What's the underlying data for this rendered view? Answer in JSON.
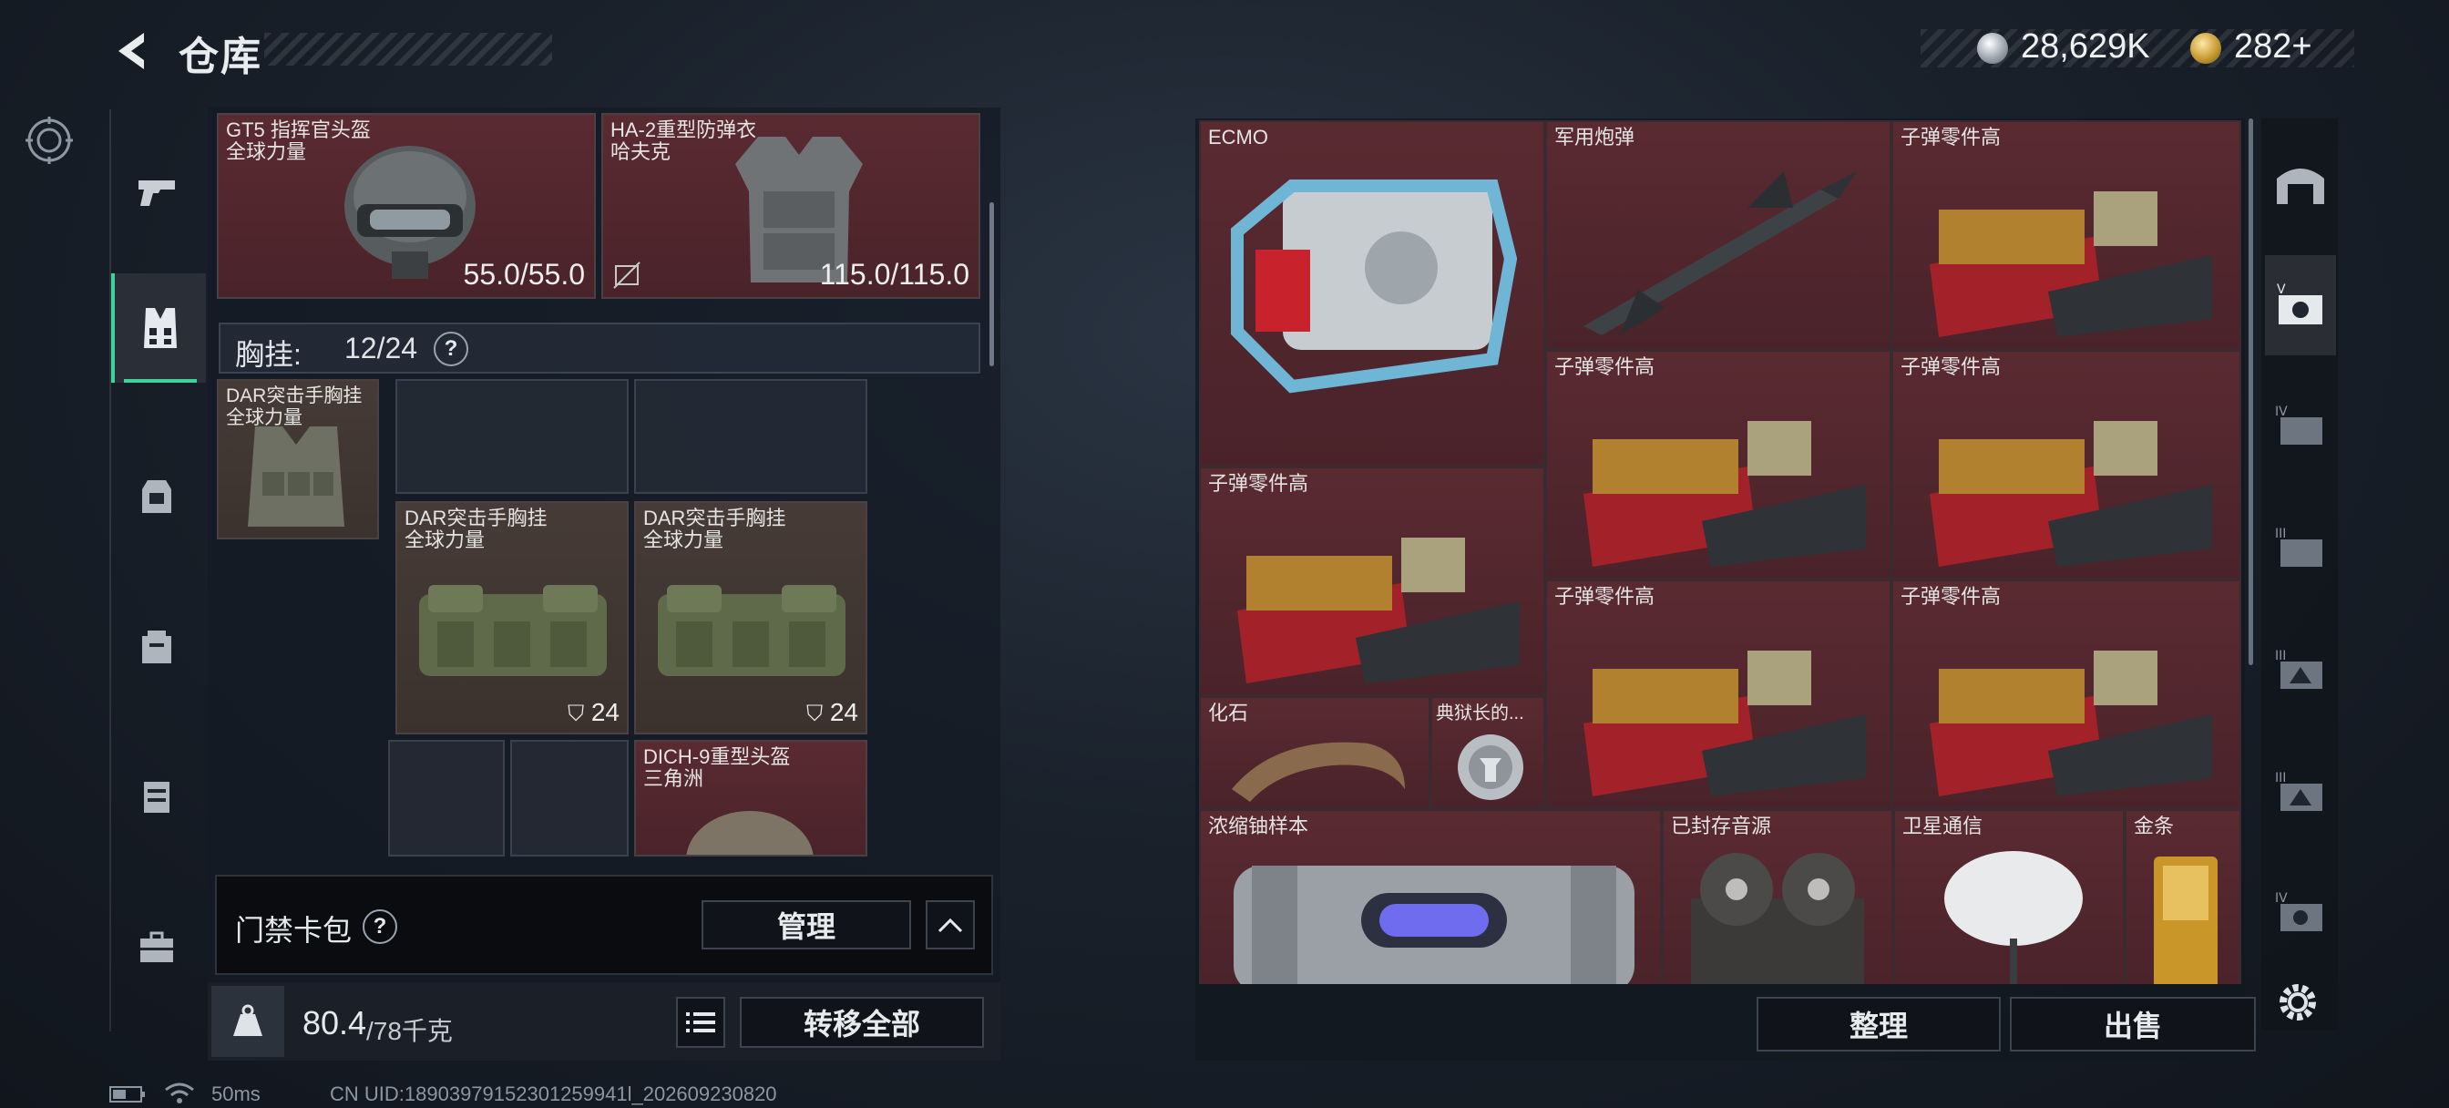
{
  "header": {
    "title": "仓库"
  },
  "currency": {
    "silver": "28,629K",
    "gold": "282",
    "gold_plus": "+"
  },
  "loadout": {
    "helmet": {
      "name": "GT5 指挥官头盔",
      "faction": "全球力量",
      "durability": "55.0/55.0"
    },
    "armor": {
      "name": "HA-2重型防弹衣",
      "faction": "哈夫克",
      "durability": "115.0/115.0"
    },
    "vest_header": {
      "label": "胸挂:",
      "count": "12/24",
      "help": "?"
    },
    "vest_equipped": {
      "name": "DAR突击手胸挂",
      "faction": "全球力量"
    },
    "vest_items": [
      {
        "name": "DAR突击手胸挂",
        "faction": "全球力量",
        "count": "24"
      },
      {
        "name": "DAR突击手胸挂",
        "faction": "全球力量",
        "count": "24"
      }
    ],
    "helmet_item": {
      "name": "DICH-9重型头盔",
      "faction": "三角洲"
    },
    "keycard": {
      "label": "门禁卡包",
      "help": "?",
      "manage": "管理"
    },
    "weight": {
      "current": "80.4",
      "max": "/78千克"
    },
    "transfer_all": "转移全部"
  },
  "warehouse": {
    "items": {
      "ecmo": "ECMO",
      "shell": "军用炮弹",
      "ammo_parts": "子弹零件高",
      "fossil": "化石",
      "warden": "典狱长的...",
      "uranium": "浓缩铀样本",
      "audio": "已封存音源",
      "satellite": "卫星通信",
      "gold_bar": "金条"
    },
    "sort": "整理",
    "sell": "出售"
  },
  "status": {
    "ping": "50ms",
    "uid": "CN UID:18903979152301259941l_202609230820"
  },
  "colors": {
    "accent": "#3fd39a",
    "item_red": "#5a2a31",
    "item_brown": "#463b36"
  }
}
